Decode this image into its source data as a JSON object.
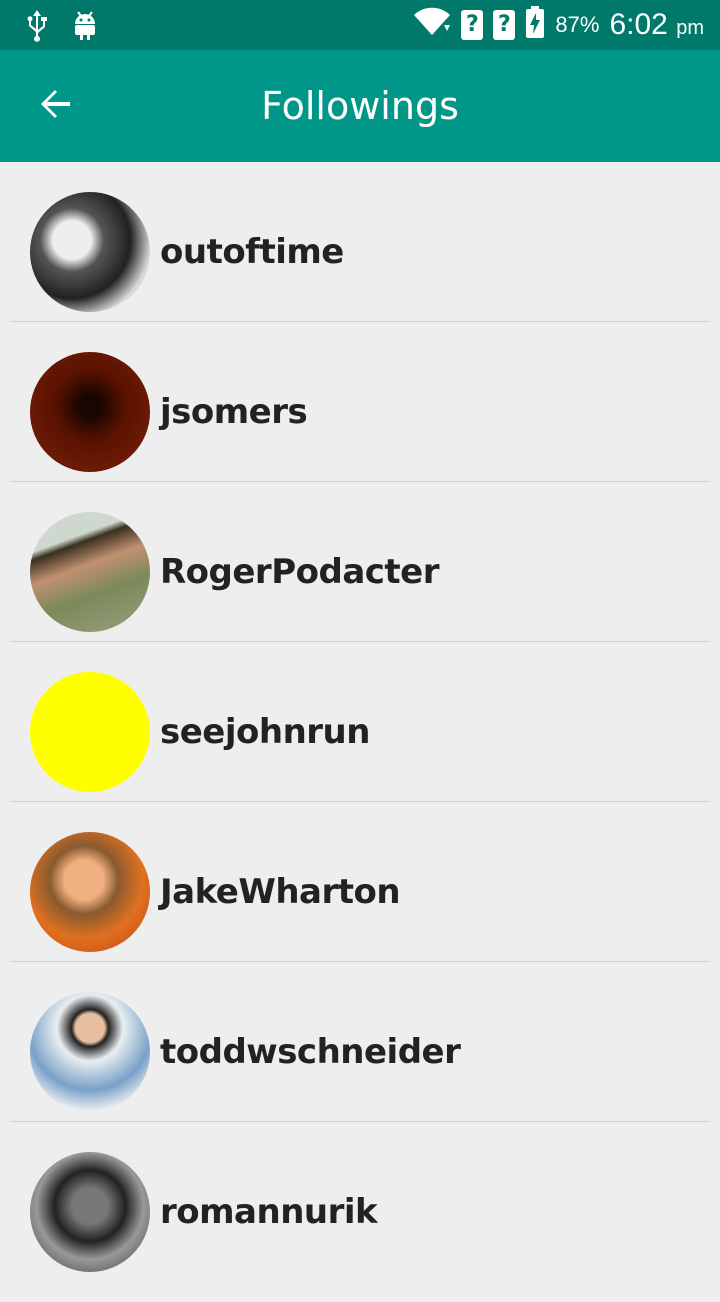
{
  "status_bar": {
    "battery_percent": "87%",
    "time": "6:02",
    "ampm": "pm",
    "icons": [
      "usb-icon",
      "android-icon",
      "wifi-icon",
      "sim1-unknown-icon",
      "sim2-unknown-icon",
      "battery-charging-icon"
    ]
  },
  "appbar": {
    "title": "Followings",
    "back_icon": "arrow-back-icon",
    "color": "#009688"
  },
  "followings": [
    {
      "username": "outoftime"
    },
    {
      "username": "jsomers"
    },
    {
      "username": "RogerPodacter"
    },
    {
      "username": "seejohnrun"
    },
    {
      "username": "JakeWharton"
    },
    {
      "username": "toddwschneider"
    },
    {
      "username": "romannurik"
    }
  ]
}
